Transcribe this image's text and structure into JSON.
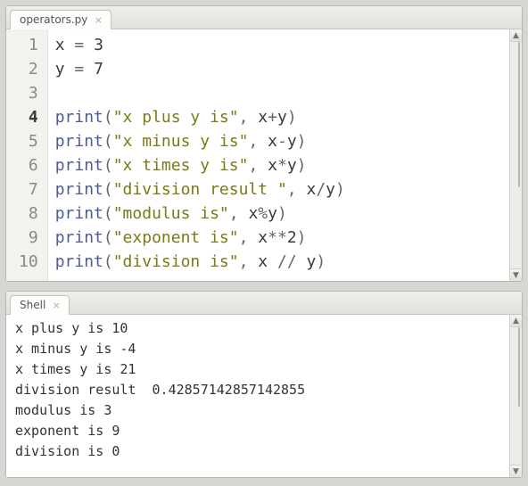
{
  "editor": {
    "tab_label": "operators.py",
    "current_line": 4,
    "tokens": [
      [
        {
          "t": "id",
          "v": "x"
        },
        {
          "t": "sp",
          "v": " "
        },
        {
          "t": "op",
          "v": "="
        },
        {
          "t": "sp",
          "v": " "
        },
        {
          "t": "num",
          "v": "3"
        }
      ],
      [
        {
          "t": "id",
          "v": "y"
        },
        {
          "t": "sp",
          "v": " "
        },
        {
          "t": "op",
          "v": "="
        },
        {
          "t": "sp",
          "v": " "
        },
        {
          "t": "num",
          "v": "7"
        }
      ],
      [],
      [
        {
          "t": "fn",
          "v": "print"
        },
        {
          "t": "par",
          "v": "("
        },
        {
          "t": "str",
          "v": "\"x plus y is\""
        },
        {
          "t": "op",
          "v": ","
        },
        {
          "t": "sp",
          "v": " "
        },
        {
          "t": "id",
          "v": "x"
        },
        {
          "t": "op",
          "v": "+"
        },
        {
          "t": "id",
          "v": "y"
        },
        {
          "t": "par",
          "v": ")"
        }
      ],
      [
        {
          "t": "fn",
          "v": "print"
        },
        {
          "t": "par",
          "v": "("
        },
        {
          "t": "str",
          "v": "\"x minus y is\""
        },
        {
          "t": "op",
          "v": ","
        },
        {
          "t": "sp",
          "v": " "
        },
        {
          "t": "id",
          "v": "x"
        },
        {
          "t": "op",
          "v": "-"
        },
        {
          "t": "id",
          "v": "y"
        },
        {
          "t": "par",
          "v": ")"
        }
      ],
      [
        {
          "t": "fn",
          "v": "print"
        },
        {
          "t": "par",
          "v": "("
        },
        {
          "t": "str",
          "v": "\"x times y is\""
        },
        {
          "t": "op",
          "v": ","
        },
        {
          "t": "sp",
          "v": " "
        },
        {
          "t": "id",
          "v": "x"
        },
        {
          "t": "op",
          "v": "*"
        },
        {
          "t": "id",
          "v": "y"
        },
        {
          "t": "par",
          "v": ")"
        }
      ],
      [
        {
          "t": "fn",
          "v": "print"
        },
        {
          "t": "par",
          "v": "("
        },
        {
          "t": "str",
          "v": "\"division result \""
        },
        {
          "t": "op",
          "v": ","
        },
        {
          "t": "sp",
          "v": " "
        },
        {
          "t": "id",
          "v": "x"
        },
        {
          "t": "op",
          "v": "/"
        },
        {
          "t": "id",
          "v": "y"
        },
        {
          "t": "par",
          "v": ")"
        }
      ],
      [
        {
          "t": "fn",
          "v": "print"
        },
        {
          "t": "par",
          "v": "("
        },
        {
          "t": "str",
          "v": "\"modulus is\""
        },
        {
          "t": "op",
          "v": ","
        },
        {
          "t": "sp",
          "v": " "
        },
        {
          "t": "id",
          "v": "x"
        },
        {
          "t": "op",
          "v": "%"
        },
        {
          "t": "id",
          "v": "y"
        },
        {
          "t": "par",
          "v": ")"
        }
      ],
      [
        {
          "t": "fn",
          "v": "print"
        },
        {
          "t": "par",
          "v": "("
        },
        {
          "t": "str",
          "v": "\"exponent is\""
        },
        {
          "t": "op",
          "v": ","
        },
        {
          "t": "sp",
          "v": " "
        },
        {
          "t": "id",
          "v": "x"
        },
        {
          "t": "op",
          "v": "**"
        },
        {
          "t": "num",
          "v": "2"
        },
        {
          "t": "par",
          "v": ")"
        }
      ],
      [
        {
          "t": "fn",
          "v": "print"
        },
        {
          "t": "par",
          "v": "("
        },
        {
          "t": "str",
          "v": "\"division is\""
        },
        {
          "t": "op",
          "v": ","
        },
        {
          "t": "sp",
          "v": " "
        },
        {
          "t": "id",
          "v": "x"
        },
        {
          "t": "sp",
          "v": " "
        },
        {
          "t": "op",
          "v": "//"
        },
        {
          "t": "sp",
          "v": " "
        },
        {
          "t": "id",
          "v": "y"
        },
        {
          "t": "par",
          "v": ")"
        }
      ]
    ]
  },
  "shell": {
    "tab_label": "Shell",
    "lines": [
      "x plus y is 10",
      "x minus y is -4",
      "x times y is 21",
      "division result  0.42857142857142855",
      "modulus is 3",
      "exponent is 9",
      "division is 0"
    ]
  }
}
